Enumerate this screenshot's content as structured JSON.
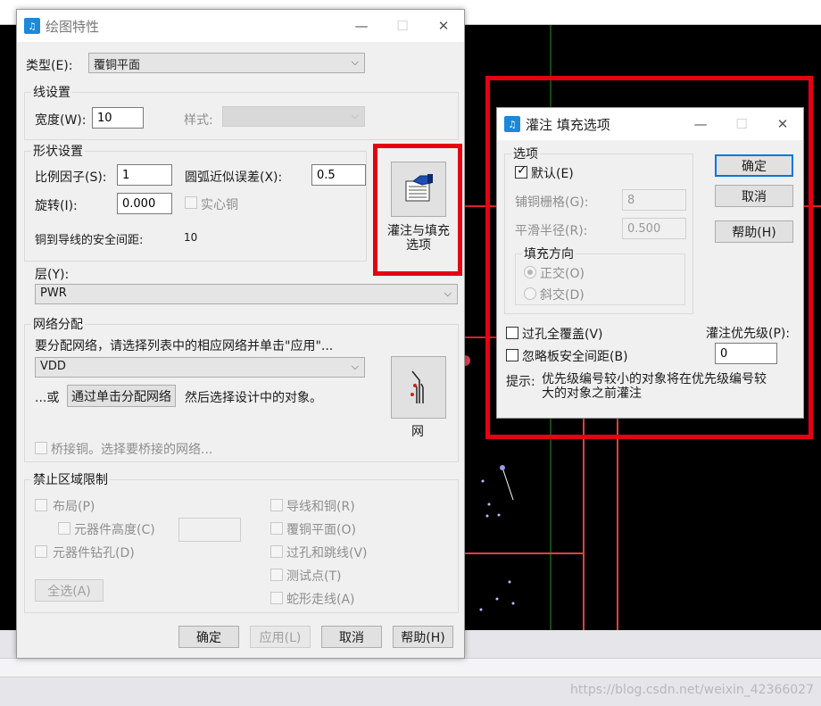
{
  "colors": {
    "highlight_red": "#e60012",
    "canvas": "#000000",
    "accent": "#0078d7"
  },
  "dialog1": {
    "title": "绘图特性",
    "type_label": "类型(E):",
    "type_value": "覆铜平面",
    "line_group": "线设置",
    "width_label": "宽度(W):",
    "width_value": "10",
    "style_label": "样式:",
    "shape_group": "形状设置",
    "scale_label": "比例因子(S):",
    "scale_value": "1",
    "arc_label": "圆弧近似误差(X):",
    "arc_value": "0.5",
    "rotate_label": "旋转(I):",
    "rotate_value": "0.000",
    "solid_label": "实心铜",
    "clearance_label": "铜到导线的安全间距:",
    "clearance_value": "10",
    "pour_button_label": "灌注与填充\n选项",
    "layer_label": "层(Y):",
    "layer_value": "PWR",
    "net_group": "网络分配",
    "net_hint": "要分配网络，请选择列表中的相应网络并单击\"应用\"...",
    "net_value": "VDD",
    "or_label": "...或",
    "click_assign": "通过单击分配网络",
    "then_select": "然后选择设计中的对象。",
    "net_button_label": "网",
    "bridge_label": "桥接铜。选择要桥接的网络...",
    "keepout_group": "禁止区域限制",
    "keepout_left": [
      "布局(P)",
      "元器件高度(C)",
      "元器件钻孔(D)"
    ],
    "keepout_right": [
      "导线和铜(R)",
      "覆铜平面(O)",
      "过孔和跳线(V)",
      "测试点(T)",
      "蛇形走线(A)"
    ],
    "select_all": "全选(A)",
    "ok": "确定",
    "apply": "应用(L)",
    "cancel": "取消",
    "help": "帮助(H)"
  },
  "dialog2": {
    "title": "灌注  填充选项",
    "options_group": "选项",
    "default_label": "默认(E)",
    "grid_label": "铺铜栅格(G):",
    "grid_value": "8",
    "smooth_label": "平滑半径(R):",
    "smooth_value": "0.500",
    "fill_dir_group": "填充方向",
    "orthogonal": "正交(O)",
    "diagonal": "斜交(D)",
    "via_cover": "过孔全覆盖(V)",
    "ignore_board": "忽略板安全间距(B)",
    "priority_label": "灌注优先级(P):",
    "priority_value": "0",
    "tip_label": "提示:",
    "tip_text": "优先级编号较小的对象将在优先级编号较\n大的对象之前灌注",
    "ok": "确定",
    "cancel": "取消",
    "help": "帮助(H)"
  },
  "watermark": "https://blog.csdn.net/weixin_42366027"
}
